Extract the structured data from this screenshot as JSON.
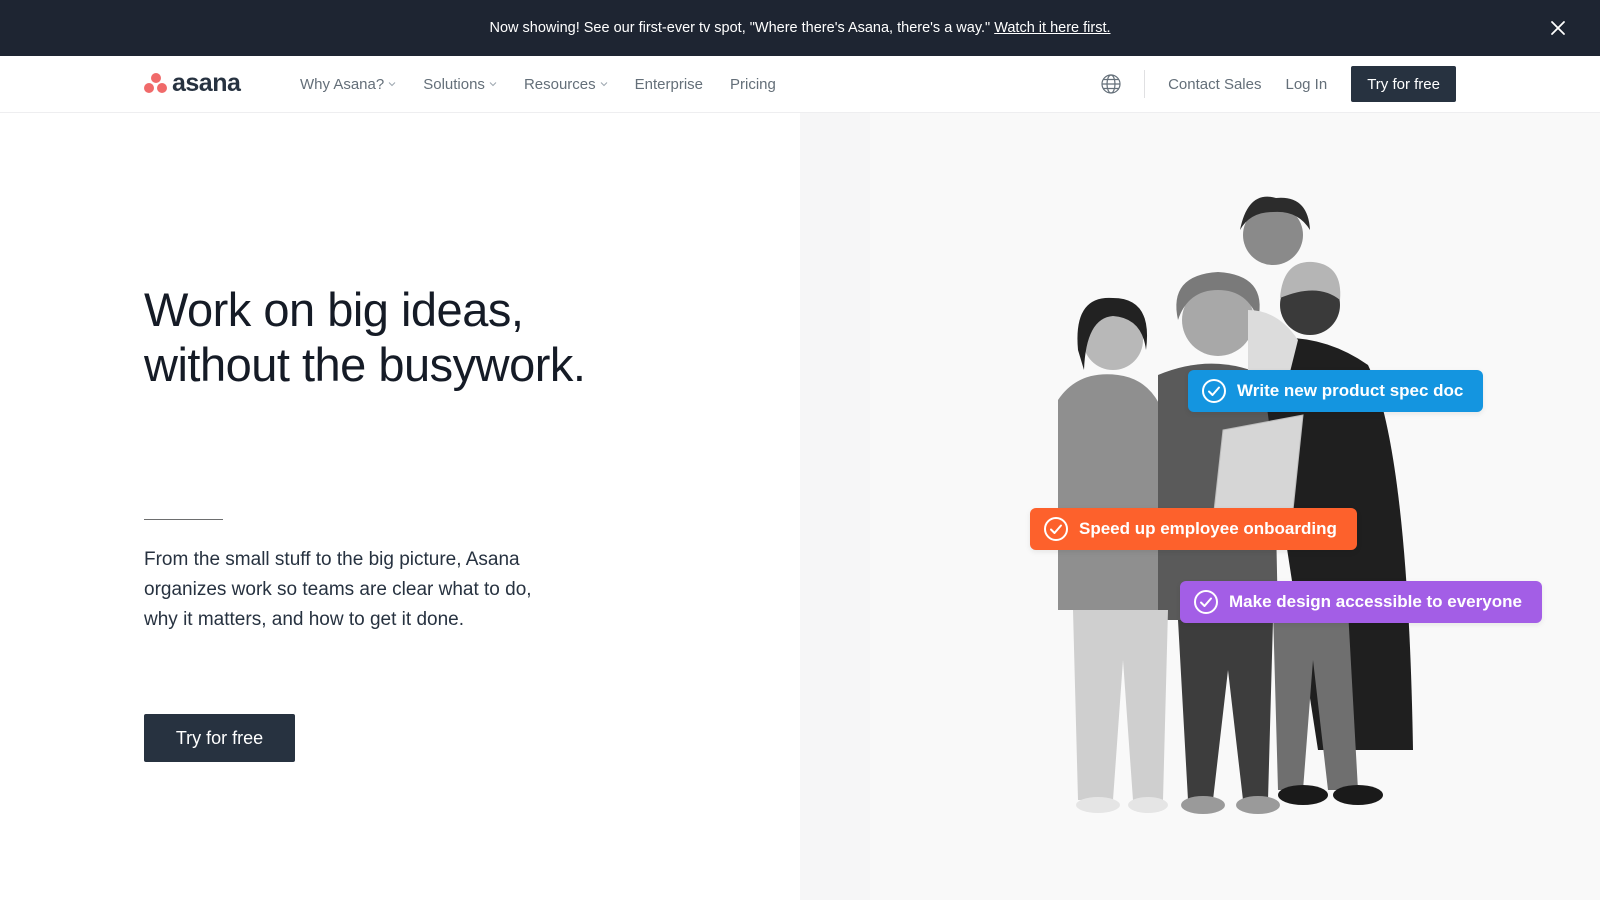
{
  "announcement": {
    "message": "Now showing! See our first-ever tv spot, \"Where there's Asana, there's a way.\"",
    "link": "Watch it here first.",
    "close_icon": "close-icon"
  },
  "nav": {
    "logo": "asana",
    "menu": [
      {
        "label": "Why Asana?",
        "dropdown": true
      },
      {
        "label": "Solutions",
        "dropdown": true
      },
      {
        "label": "Resources",
        "dropdown": true
      },
      {
        "label": "Enterprise",
        "dropdown": false
      },
      {
        "label": "Pricing",
        "dropdown": false
      }
    ],
    "globe_icon": "globe-icon",
    "contact_sales": "Contact Sales",
    "log_in": "Log In",
    "cta": "Try for free"
  },
  "hero": {
    "headline_line1": "Work on big ideas,",
    "headline_line2": "without the busywork.",
    "lede": "From the small stuff to the big picture, Asana organizes work so teams are clear what to do, why it matters, and how to get it done.",
    "cta": "Try for free",
    "tasks": [
      {
        "label": "Write new product spec doc",
        "color": "#1495e0"
      },
      {
        "label": "Speed up employee onboarding",
        "color": "#fd612c"
      },
      {
        "label": "Make design accessible to everyone",
        "color": "#a35ee6"
      }
    ]
  },
  "colors": {
    "dark": "#1e2532",
    "button": "#273240",
    "brand_coral": "#f06a6a"
  }
}
